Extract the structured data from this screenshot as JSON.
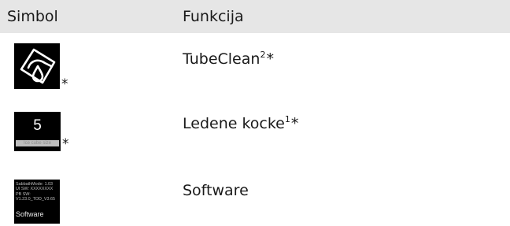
{
  "table": {
    "headers": {
      "symbol": "Simbol",
      "function": "Funkcija"
    },
    "rows": [
      {
        "icon": "tube-clean-icon",
        "function_name": "TubeClean",
        "footnote": "2",
        "marker": "*",
        "icon_marker": "*"
      },
      {
        "icon": "ice-cubes-icon",
        "icon_value": "5",
        "icon_caption": "Ice cube size",
        "function_name": "Ledene kocke",
        "footnote": "1",
        "marker": "*",
        "icon_marker": "*"
      },
      {
        "icon": "software-info-icon",
        "icon_lines": [
          "SabbathMode: 1.03",
          "UI SW: XXXXXXXX",
          "PB SW:",
          "V1.23.0_TOD_V3.65"
        ],
        "icon_title": "Software",
        "function_name": "Software"
      }
    ]
  },
  "colors": {
    "header_background": "#e6e6e6",
    "icon_background": "#000000",
    "text": "#1a1a1a"
  }
}
